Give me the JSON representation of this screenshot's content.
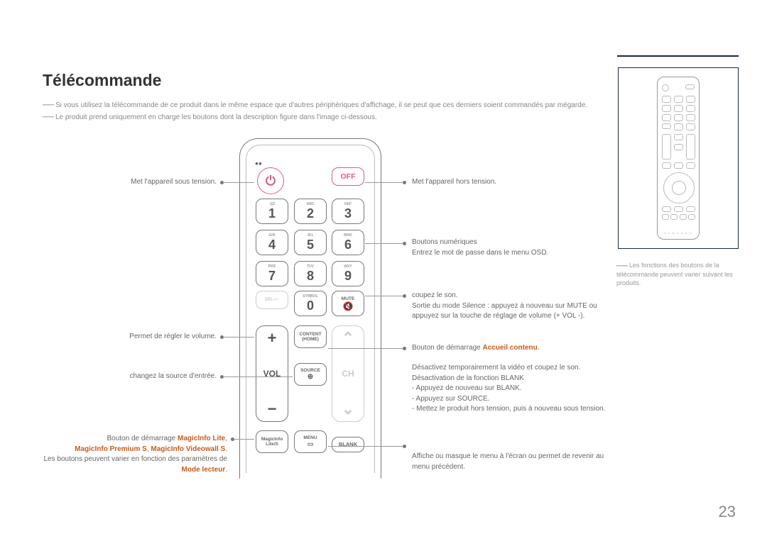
{
  "title": "Télécommande",
  "notes": [
    "Si vous utilisez la télécommande de ce produit dans le même espace que d'autres périphériques d'affichage, il se peut que ces derniers soient commandés par mégarde.",
    "Le produit prend uniquement en charge les boutons dont la description figure dans l'image ci-dessous."
  ],
  "side_note": "Les fonctions des boutons de la télécommande peuvent varier suivant les produits.",
  "page_number": "23",
  "remote": {
    "off_label": "OFF",
    "keys": {
      "k1s": "·QZ",
      "k1": "1",
      "k2s": "ABC",
      "k2": "2",
      "k3s": "DEF",
      "k3": "3",
      "k4s": "GHI",
      "k4": "4",
      "k5s": "JKL",
      "k5": "5",
      "k6s": "MNO",
      "k6": "6",
      "k7s": "PRS",
      "k7": "7",
      "k8s": "TUV",
      "k8": "8",
      "k9s": "WXY",
      "k9": "9",
      "k0s": "SYMBOL",
      "k0": "0",
      "del": "DEL-/--",
      "mute": "MUTE",
      "content1": "CONTENT",
      "content2": "(HOME)",
      "source": "SOURCE",
      "magicinfo1": "MagicInfo",
      "magicinfo2": "Lite/S",
      "menu": "MENU",
      "blank": "BLANK",
      "vol": "VOL",
      "ch": "CH",
      "plus": "+",
      "minus": "−"
    }
  },
  "callouts": {
    "power_on": "Met l'appareil sous tension.",
    "power_off": "Met l'appareil hors tension.",
    "numeric_1": "Boutons numériques",
    "numeric_2": "Entrez le mot de passe dans le menu OSD.",
    "mute_1": "coupez le son.",
    "mute_2": "Sortie du mode Silence : appuyez à nouveau sur MUTE ou appuyez sur la touche de réglage de volume (+ VOL  -).",
    "volume": "Permet de régler le volume.",
    "source": "changez la source d'entrée.",
    "content_home_pre": "Bouton de démarrage ",
    "content_home_hl": "Accueil contenu",
    "blank_1": "Désactivez  temporairement la vidéo et coupez le son.",
    "blank_2": "Désactivation de la fonction BLANK",
    "blank_3": "- Appuyez de nouveau sur BLANK.",
    "blank_4": "- Appuyez sur SOURCE.",
    "blank_5": "  - Mettez le produit hors tension, puis à nouveau sous tension.",
    "menu": "Affiche ou masque le menu à l'écran ou permet de revenir au menu précédent.",
    "magicinfo_pre": "Bouton de démarrage ",
    "magicinfo_hl1": "MagicInfo Lite",
    "magicinfo_mid": ", ",
    "magicinfo_hl2": "MagicInfo Premium S",
    "magicinfo_mid2": ", ",
    "magicinfo_hl3": "MagicInfo Videowall S",
    "magicinfo_end": ".",
    "magicinfo_2": "Les boutons peuvent varier en fonction des paramètres de ",
    "magicinfo_2hl": "Mode lecteur",
    "magicinfo_2end": "."
  }
}
